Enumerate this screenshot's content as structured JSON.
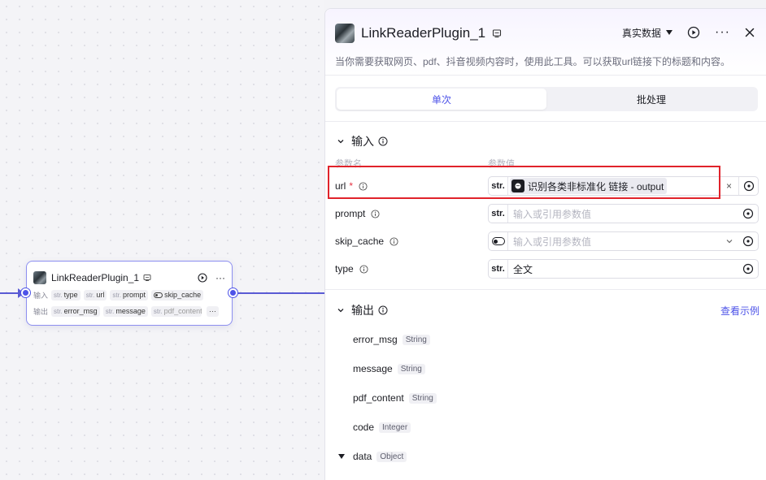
{
  "node": {
    "title": "LinkReaderPlugin_1",
    "input_label": "输入",
    "output_label": "输出",
    "inputs": [
      {
        "type": "str.",
        "name": "type"
      },
      {
        "type": "str.",
        "name": "url"
      },
      {
        "type": "str.",
        "name": "prompt"
      },
      {
        "type": "toggle",
        "name": "skip_cache"
      }
    ],
    "outputs": [
      {
        "type": "str.",
        "name": "error_msg"
      },
      {
        "type": "str.",
        "name": "message"
      },
      {
        "type": "str.",
        "name": "pdf_content"
      }
    ],
    "more": "···"
  },
  "panel": {
    "title": "LinkReaderPlugin_1",
    "data_mode": "真实数据",
    "description": "当你需要获取网页、pdf、抖音视频内容时，使用此工具。可以获取url链接下的标题和内容。",
    "tabs": [
      {
        "label": "单次",
        "active": true
      },
      {
        "label": "批处理",
        "active": false
      }
    ],
    "input_section": {
      "title": "输入",
      "col_name": "参数名",
      "col_value": "参数值",
      "params": [
        {
          "name": "url",
          "required": "*",
          "type": "str.",
          "value": "",
          "ref": "识别各类非标准化 链接 - output",
          "placeholder": ""
        },
        {
          "name": "prompt",
          "required": "",
          "type": "str.",
          "value": "",
          "placeholder": "输入或引用参数值"
        },
        {
          "name": "skip_cache",
          "required": "",
          "type": "toggle",
          "value": "",
          "placeholder": "输入或引用参数值"
        },
        {
          "name": "type",
          "required": "",
          "type": "str.",
          "value": "全文",
          "placeholder": ""
        }
      ]
    },
    "output_section": {
      "title": "输出",
      "view_example": "查看示例",
      "outputs": [
        {
          "name": "error_msg",
          "type": "String"
        },
        {
          "name": "message",
          "type": "String"
        },
        {
          "name": "pdf_content",
          "type": "String"
        },
        {
          "name": "code",
          "type": "Integer"
        },
        {
          "name": "data",
          "type": "Object"
        }
      ]
    }
  },
  "colors": {
    "accent": "#4d53e8",
    "highlight_box": "#e0232b"
  }
}
